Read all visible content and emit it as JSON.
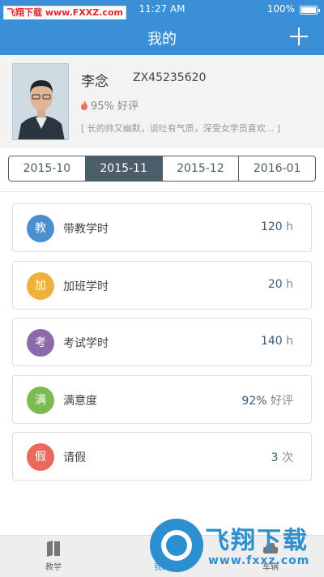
{
  "status_bar": {
    "time": "11:27 AM",
    "battery": "100%"
  },
  "watermark_top": {
    "brand": "飞翔下载",
    "site": "www.FXXZ.com"
  },
  "navbar": {
    "title": "我的"
  },
  "profile": {
    "name": "李念",
    "code": "ZX45235620",
    "rating": "95% 好评",
    "motto": "[ 长的帅又幽默，谈吐有气质，深受女学员喜欢... ]"
  },
  "tabs": [
    {
      "label": "2015-10",
      "active": false
    },
    {
      "label": "2015-11",
      "active": true
    },
    {
      "label": "2015-12",
      "active": false
    },
    {
      "label": "2016-01",
      "active": false
    }
  ],
  "stats": [
    {
      "badge": "教",
      "label": "带教学时",
      "value": "120",
      "unit": "h",
      "color": "#4a90d0"
    },
    {
      "badge": "加",
      "label": "加班学时",
      "value": "20",
      "unit": "h",
      "color": "#f0b13c"
    },
    {
      "badge": "考",
      "label": "考试学时",
      "value": "140",
      "unit": "h",
      "color": "#8a6aaa"
    },
    {
      "badge": "满",
      "label": "满意度",
      "value": "92%",
      "unit": "好评",
      "color": "#7cbb4f"
    },
    {
      "badge": "假",
      "label": "请假",
      "value": "3",
      "unit": "次",
      "color": "#e96a5c"
    }
  ],
  "tabbar": [
    {
      "label": "教学",
      "active": false
    },
    {
      "label": "我的",
      "active": true
    },
    {
      "label": "车辆",
      "active": false
    }
  ],
  "watermark_bottom": {
    "title": "飞翔下载",
    "url": "www.fxxz.com"
  }
}
